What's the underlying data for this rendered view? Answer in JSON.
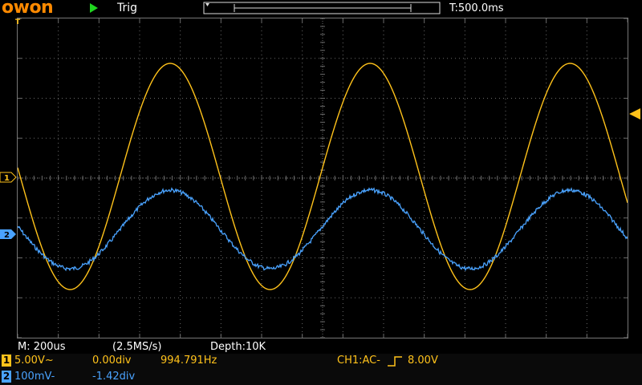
{
  "header": {
    "logo": "owon",
    "run_state_icon": "play-icon",
    "trigger_status": "Trig",
    "timebase": "T:500.0ms"
  },
  "status": {
    "timebase": "M: 200us",
    "sample_rate": "(2.5MS/s)",
    "depth": "Depth:10K"
  },
  "channels": [
    {
      "badge": "1",
      "scale": "5.00V~",
      "offset": "0.00div",
      "frequency": "994.791Hz",
      "trigger": "CH1:AC-",
      "trigger_level": "8.00V",
      "color": "#ffc21a"
    },
    {
      "badge": "2",
      "scale": "100mV-",
      "offset": "-1.42div",
      "color": "#4aa3ff"
    }
  ],
  "markers": {
    "ch1": "1",
    "ch2": "2",
    "trigger_left": "T"
  },
  "colors": {
    "ch1": "#ffc21a",
    "ch2": "#4aa3ff",
    "grid": "#6a6a6a",
    "brand": "#ff8a00"
  },
  "waveforms": {
    "ch1_periods_on_screen": 3.05,
    "ch2_periods_on_screen": 3.05
  }
}
